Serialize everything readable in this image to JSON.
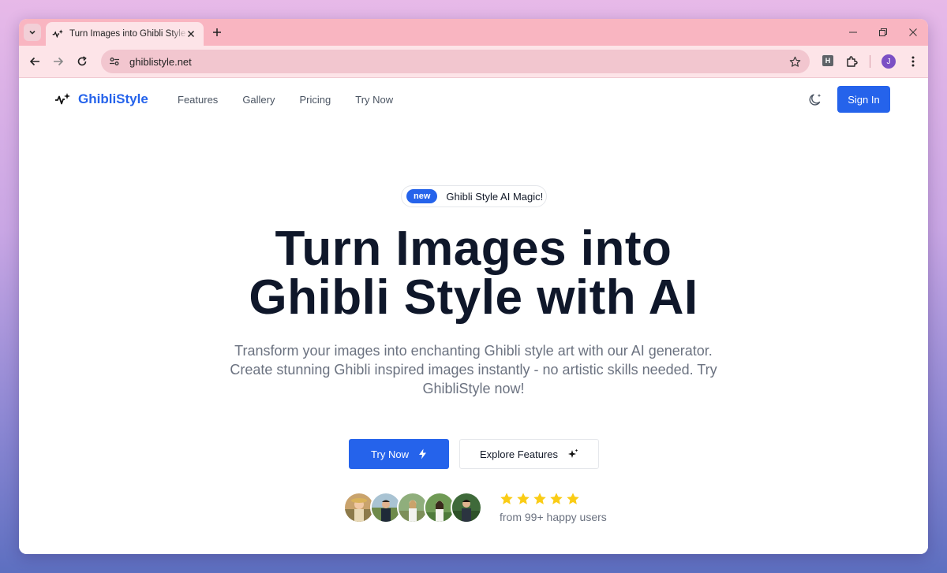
{
  "browser": {
    "tab_title": "Turn Images into Ghibli Style with AI",
    "url": "ghiblistyle.net",
    "profile_initial": "J",
    "extension_letter": "H"
  },
  "site": {
    "brand": "GhibliStyle",
    "nav": [
      {
        "label": "Features"
      },
      {
        "label": "Gallery"
      },
      {
        "label": "Pricing"
      },
      {
        "label": "Try Now"
      }
    ],
    "sign_in_label": "Sign In"
  },
  "hero": {
    "badge_new": "new",
    "badge_text": "Ghibli Style AI Magic!",
    "title_line1": "Turn Images into",
    "title_line2": "Ghibli Style with AI",
    "subtitle": "Transform your images into enchanting Ghibli style art with our AI generator. Create stunning Ghibli inspired images instantly - no artistic skills needed. Try GhibliStyle now!",
    "primary_cta": "Try Now",
    "secondary_cta": "Explore Features",
    "rating_stars": 5,
    "social_proof": "from 99+ happy users"
  },
  "colors": {
    "brand": "#2563eb",
    "star": "#facc15"
  },
  "icons": {
    "logo": "sparkle-pulse-icon",
    "theme": "moon-icon",
    "primary_cta": "lightning-icon",
    "secondary_cta": "sparkles-icon"
  }
}
